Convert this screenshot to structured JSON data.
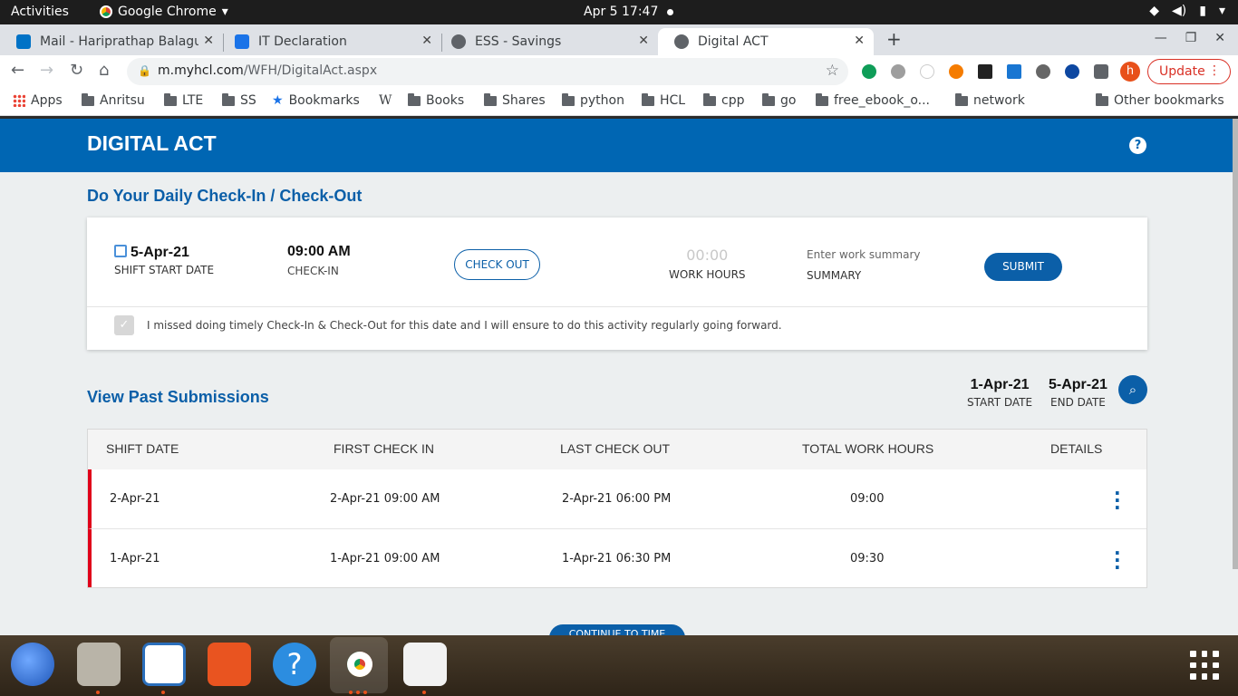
{
  "topbar": {
    "activities": "Activities",
    "app_name": "Google Chrome",
    "clock": "Apr 5  17:47"
  },
  "browser": {
    "tabs": [
      {
        "title": "Mail - Hariprathap Balagu",
        "icon": "outlook-icon",
        "color": "#0072c6"
      },
      {
        "title": "IT Declaration",
        "icon": "contacts-icon",
        "color": "#1a73e8"
      },
      {
        "title": "ESS - Savings",
        "icon": "globe-icon",
        "color": "#5f6368"
      },
      {
        "title": "Digital ACT",
        "icon": "globe-icon",
        "color": "#5f6368"
      }
    ],
    "url_host": "m.myhcl.com",
    "url_path": "/WFH/DigitalAct.aspx",
    "profile_initial": "h",
    "update_label": "Update",
    "bookmarks": [
      "Apps",
      "Anritsu",
      "LTE",
      "SS",
      "Bookmarks",
      "W",
      "Books",
      "Shares",
      "python",
      "HCL",
      "cpp",
      "go",
      "free_ebook_o...",
      "network",
      "Other bookmarks"
    ]
  },
  "app": {
    "title": "DIGITAL ACT",
    "help": "?",
    "checkin_section": "Do Your Daily Check-In / Check-Out",
    "shift_start_date": "5-Apr-21",
    "shift_start_label": "SHIFT START DATE",
    "checkin_time": "09:00 AM",
    "checkin_label": "CHECK-IN",
    "checkout_button": "CHECK OUT",
    "work_hours": "00:00",
    "work_hours_label": "WORK HOURS",
    "summary_placeholder": "Enter work summary",
    "summary_label": "SUMMARY",
    "submit_button": "SUBMIT",
    "acknowledge_text": "I missed doing timely Check-In & Check-Out for this date and I will ensure to do this activity regularly going forward.",
    "past_section": "View Past Submissions",
    "start_date": "1-Apr-21",
    "start_date_label": "START DATE",
    "end_date": "5-Apr-21",
    "end_date_label": "END DATE",
    "table": {
      "headers": [
        "SHIFT DATE",
        "FIRST CHECK IN",
        "LAST CHECK OUT",
        "TOTAL WORK HOURS",
        "DETAILS"
      ],
      "rows": [
        [
          "2-Apr-21",
          "2-Apr-21 09:00 AM",
          "2-Apr-21 06:00 PM",
          "09:00"
        ],
        [
          "1-Apr-21",
          "1-Apr-21 09:00 AM",
          "1-Apr-21 06:30 PM",
          "09:30"
        ]
      ]
    },
    "continue_button": "CONTINUE TO TIME"
  },
  "colors": {
    "brand_blue": "#0066b3",
    "link_blue": "#0b5fa8",
    "row_marker": "#e0001a"
  }
}
